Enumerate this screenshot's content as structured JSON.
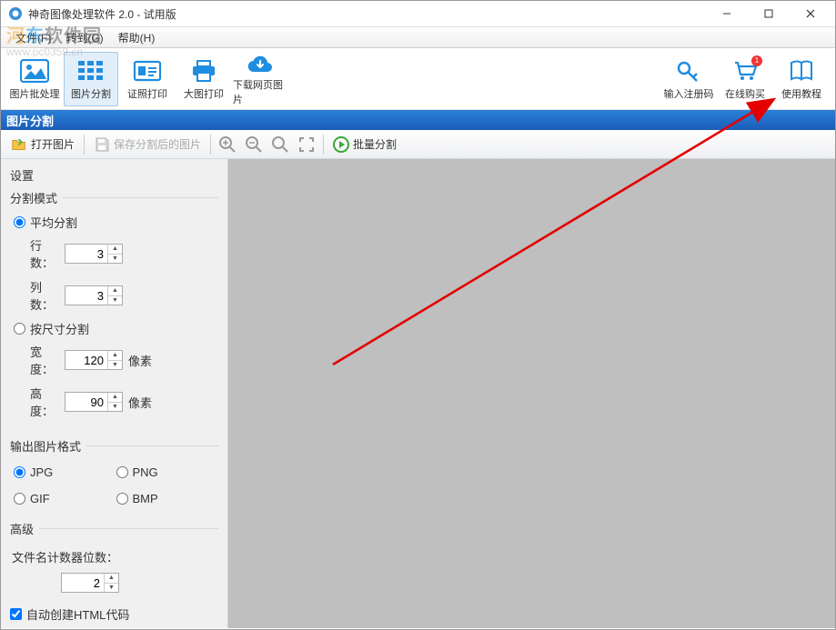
{
  "window": {
    "title": "神奇图像处理软件 2.0 - 试用版"
  },
  "watermark": {
    "line1_a": "河",
    "line1_b": "东",
    "line1_c": "软件园",
    "line2": "www.pc0359.cn"
  },
  "menu": {
    "file": "文件(F)",
    "goto": "转到(G)",
    "help": "帮助(H)"
  },
  "toolbar": {
    "batch": "图片批处理",
    "split": "图片分割",
    "cert": "证照打印",
    "bigprint": "大图打印",
    "download": "下载网页图片",
    "regcode": "输入注册码",
    "buy": "在线购买",
    "tutorial": "使用教程",
    "buy_badge": "1"
  },
  "section_title": "图片分割",
  "sec_toolbar": {
    "open": "打开图片",
    "save": "保存分割后的图片",
    "batch_split": "批量分割"
  },
  "settings": {
    "title": "设置",
    "mode_group": "分割模式",
    "avg": "平均分割",
    "rows": "行数：",
    "rows_val": "3",
    "cols": "列数：",
    "cols_val": "3",
    "bysize": "按尺寸分割",
    "width": "宽度：",
    "width_val": "120",
    "height": "高度：",
    "height_val": "90",
    "px": "像素",
    "fmt_group": "输出图片格式",
    "jpg": "JPG",
    "png": "PNG",
    "gif": "GIF",
    "bmp": "BMP",
    "adv_group": "高级",
    "counter": "文件名计数器位数：",
    "counter_val": "2",
    "autohtml": "自动创建HTML代码"
  }
}
